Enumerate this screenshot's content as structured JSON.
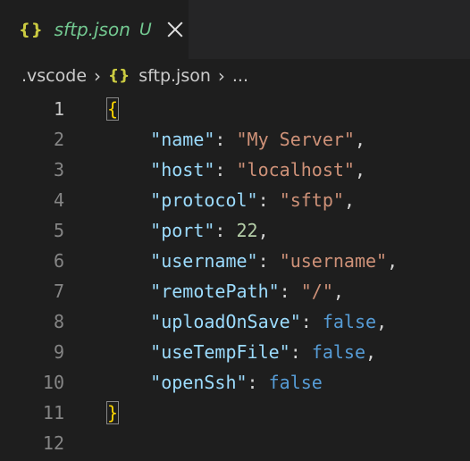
{
  "tab": {
    "icon": "{}",
    "filename": "sftp.json",
    "status": "U"
  },
  "breadcrumb": {
    "folder": ".vscode",
    "icon": "{}",
    "file": "sftp.json",
    "more": "..."
  },
  "editor": {
    "active_line": 1,
    "lines": [
      {
        "n": "1"
      },
      {
        "n": "2"
      },
      {
        "n": "3"
      },
      {
        "n": "4"
      },
      {
        "n": "5"
      },
      {
        "n": "6"
      },
      {
        "n": "7"
      },
      {
        "n": "8"
      },
      {
        "n": "9"
      },
      {
        "n": "10"
      },
      {
        "n": "11"
      },
      {
        "n": "12"
      }
    ],
    "open_brace": "{",
    "close_brace": "}",
    "entries": [
      {
        "key": "\"name\"",
        "value": "\"My Server\"",
        "type": "string",
        "comma": ","
      },
      {
        "key": "\"host\"",
        "value": "\"localhost\"",
        "type": "string",
        "comma": ","
      },
      {
        "key": "\"protocol\"",
        "value": "\"sftp\"",
        "type": "string",
        "comma": ","
      },
      {
        "key": "\"port\"",
        "value": "22",
        "type": "number",
        "comma": ","
      },
      {
        "key": "\"username\"",
        "value": "\"username\"",
        "type": "string",
        "comma": ","
      },
      {
        "key": "\"remotePath\"",
        "value": "\"/\"",
        "type": "string",
        "comma": ","
      },
      {
        "key": "\"uploadOnSave\"",
        "value": "false",
        "type": "boolean",
        "comma": ","
      },
      {
        "key": "\"useTempFile\"",
        "value": "false",
        "type": "boolean",
        "comma": ","
      },
      {
        "key": "\"openSsh\"",
        "value": "false",
        "type": "boolean",
        "comma": ""
      }
    ]
  },
  "colors": {
    "background": "#1e1e1e",
    "tab_bar": "#252526",
    "untracked_green": "#73c991",
    "json_icon": "#cbcb41",
    "brace": "#ffd700",
    "key": "#9cdcfe",
    "string": "#ce9178",
    "number": "#b5cea8",
    "boolean": "#569cd6"
  }
}
